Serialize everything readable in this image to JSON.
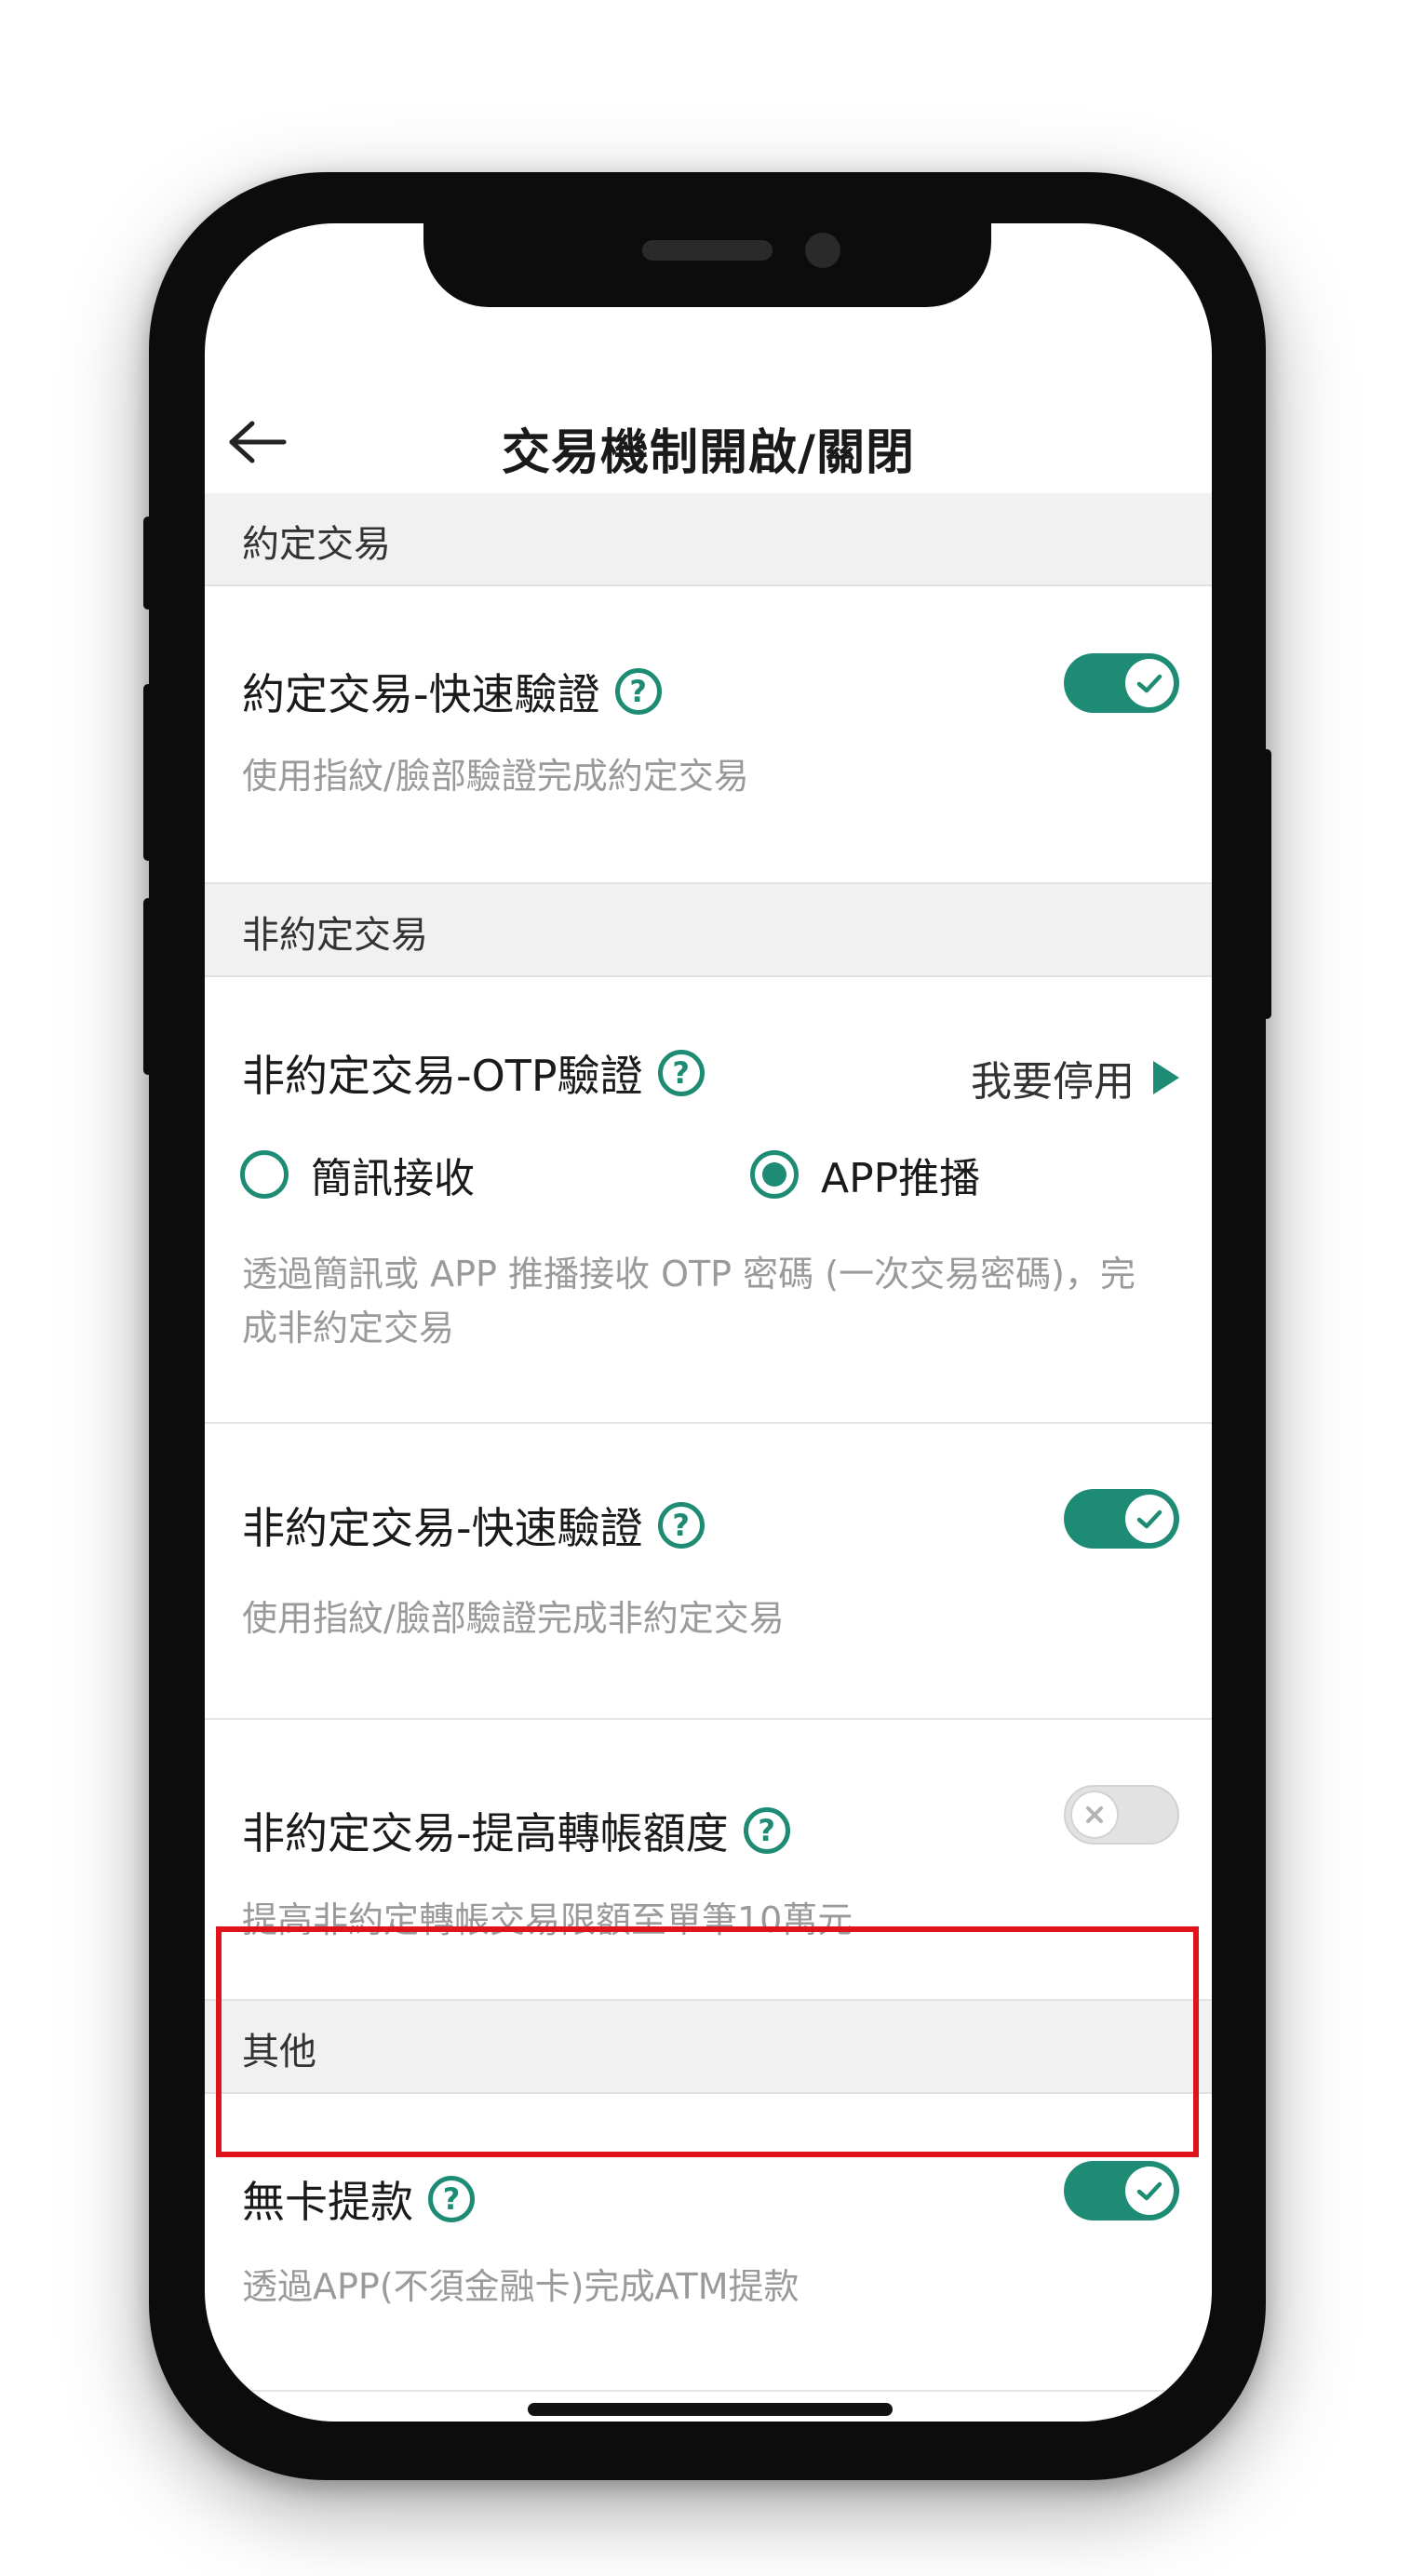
{
  "header": {
    "title": "交易機制開啟/關閉"
  },
  "sections": [
    {
      "title": "約定交易",
      "rows": [
        {
          "title": "約定交易-快速驗證",
          "description": "使用指紋/臉部驗證完成約定交易",
          "toggle": "on"
        }
      ]
    },
    {
      "title": "非約定交易",
      "rows": [
        {
          "title": "非約定交易-OTP驗證",
          "action_label": "我要停用",
          "radio_options": [
            {
              "label": "簡訊接收",
              "selected": false
            },
            {
              "label": "APP推播",
              "selected": true
            }
          ],
          "description": "透過簡訊或 APP 推播接收 OTP 密碼 (一次交易密碼)，完成非約定交易"
        },
        {
          "title": "非約定交易-快速驗證",
          "description": "使用指紋/臉部驗證完成非約定交易",
          "toggle": "on"
        },
        {
          "title": "非約定交易-提高轉帳額度",
          "description": "提高非約定轉帳交易限額至單筆10萬元",
          "toggle": "off",
          "highlighted": true
        }
      ]
    },
    {
      "title": "其他",
      "rows": [
        {
          "title": "無卡提款",
          "description": "透過APP(不須金融卡)完成ATM提款",
          "toggle": "on"
        }
      ]
    }
  ],
  "colors": {
    "accent": "#1e8c75",
    "highlight": "#e0121b",
    "section_bg": "#f1f1f1",
    "description": "#9a9a9a"
  },
  "icons": {
    "back": "arrow-left-icon",
    "help": "question-circle-icon",
    "check": "check-icon",
    "close": "x-icon",
    "play": "play-triangle-icon"
  }
}
